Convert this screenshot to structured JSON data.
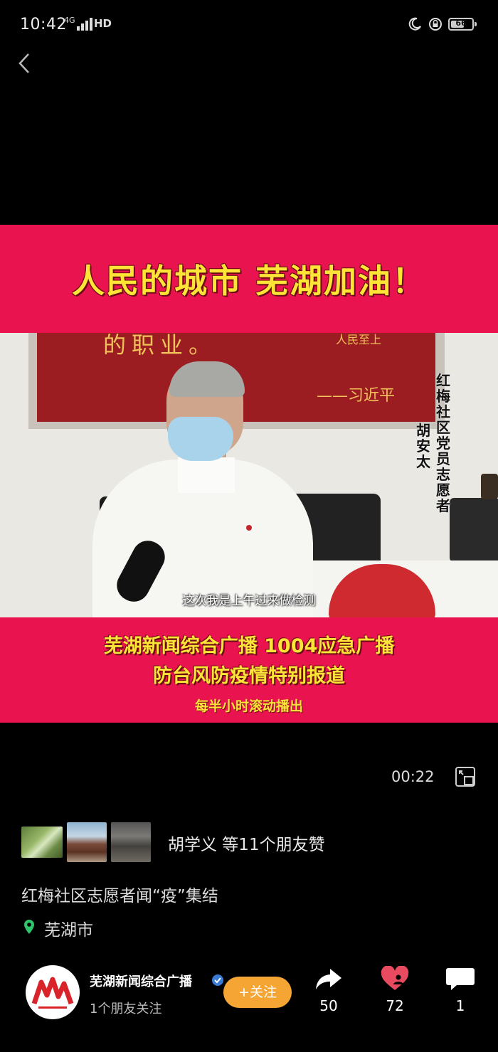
{
  "status_bar": {
    "time": "10:42",
    "network": "4G",
    "hd": "HD",
    "battery": "66",
    "battery_level_percent": 66,
    "icons": [
      "moon-icon",
      "lock-rotation-icon",
      "battery-icon",
      "signal-icon"
    ]
  },
  "navigation": {
    "back_icon": "chevron-left-icon"
  },
  "video": {
    "top_banner": "人民的城市 芜湖加油！",
    "board_text": "的职业。",
    "board_text_right": "人民至上",
    "board_signature": "——习近平",
    "caption_role": "红梅社区党员志愿者",
    "caption_name": "胡安太",
    "subtitle": "这次我是上午过来做检测",
    "bottom_banner_line1": "芜湖新闻综合广播 1004应急广播",
    "bottom_banner_line2": "防台风防疫情特别报道",
    "bottom_banner_line3": "每半小时滚动播出",
    "elapsed": "00:22",
    "fullscreen_icon": "fullscreen-icon"
  },
  "likes": {
    "text": "胡学义 等11个朋友赞",
    "avatars": [
      "tree-photo",
      "gate-photo",
      "street-photo"
    ]
  },
  "post": {
    "title": "红梅社区志愿者闻“疫”集结",
    "location": "芜湖市",
    "location_icon": "location-pin-icon"
  },
  "account": {
    "name": "芜湖新闻综合广播",
    "followers": "1个朋友关注",
    "follow_label": "+关注",
    "verified_icon": "verified-badge-icon"
  },
  "actions": {
    "share_count": "50",
    "like_count": "72",
    "comment_count": "1"
  },
  "colors": {
    "banner_red": "#e9134f",
    "banner_yellow": "#ffe438",
    "follow_orange": "#f5a533",
    "like_red": "#e84a5f",
    "location_green": "#2ec46b"
  }
}
